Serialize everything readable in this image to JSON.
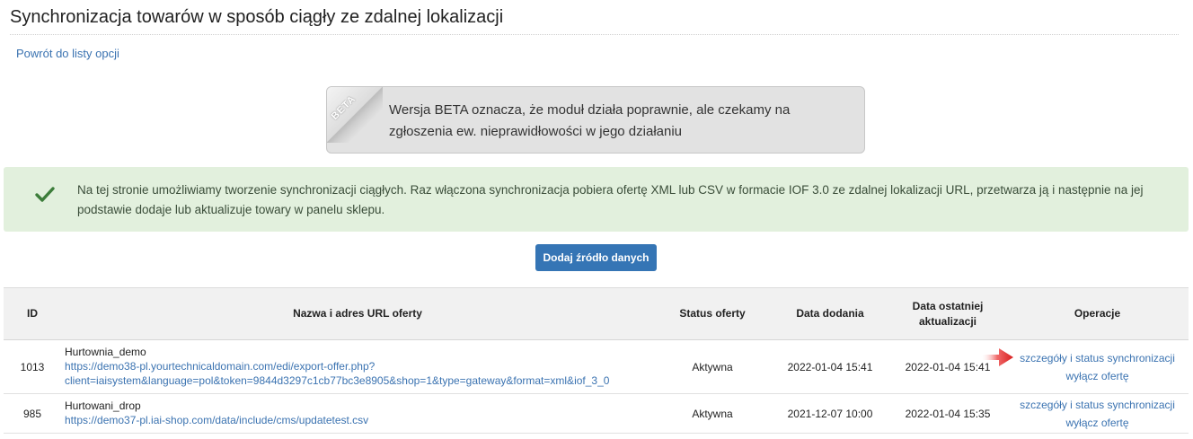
{
  "page": {
    "title": "Synchronizacja towarów w sposób ciągły ze zdalnej lokalizacji",
    "back_link": "Powrót do listy opcji"
  },
  "beta": {
    "badge": "BETA",
    "text": "Wersja BETA oznacza, że moduł działa poprawnie, ale czekamy na zgłoszenia ew. nieprawidłowości w jego działaniu"
  },
  "info": {
    "icon": "check-icon",
    "text": "Na tej stronie umożliwiamy tworzenie synchronizacji ciągłych. Raz włączona synchronizacja pobiera ofertę XML lub CSV w formacie IOF 3.0 ze zdalnej lokalizacji URL, przetwarza ją i następnie na jej podstawie dodaje lub aktualizuje towary w panelu sklepu."
  },
  "add_button": "Dodaj źródło danych",
  "table": {
    "headers": {
      "id": "ID",
      "name": "Nazwa i adres URL oferty",
      "status": "Status oferty",
      "date_added": "Data dodania",
      "date_updated": "Data ostatniej aktualizacji",
      "operations": "Operacje"
    },
    "rows": [
      {
        "id": "1013",
        "name": "Hurtownia_demo",
        "url_line1": "https://demo38-pl.yourtechnicaldomain.com/edi/export-offer.php?",
        "url_line2": "client=iaisystem&language=pol&token=9844d3297c1cb77bc3e8905&shop=1&type=gateway&format=xml&iof_3_0",
        "status": "Aktywna",
        "date_added": "2022-01-04 15:41",
        "date_updated": "2022-01-04 15:41",
        "op_details": "szczegóły i status synchronizacji",
        "op_disable": "wyłącz ofertę"
      },
      {
        "id": "985",
        "name": "Hurtowani_drop",
        "url_line1": "https://demo37-pl.iai-shop.com/data/include/cms/updatetest.csv",
        "status": "Aktywna",
        "date_added": "2021-12-07 10:00",
        "date_updated": "2022-01-04 15:35",
        "op_details": "szczegóły i status synchronizacji",
        "op_disable": "wyłącz ofertę"
      }
    ]
  },
  "colors": {
    "link": "#3b73b1",
    "button": "#3575b5",
    "success_bg": "#e2f0dd",
    "status_active": "#3c8c2f",
    "arrow": "#e02424"
  }
}
